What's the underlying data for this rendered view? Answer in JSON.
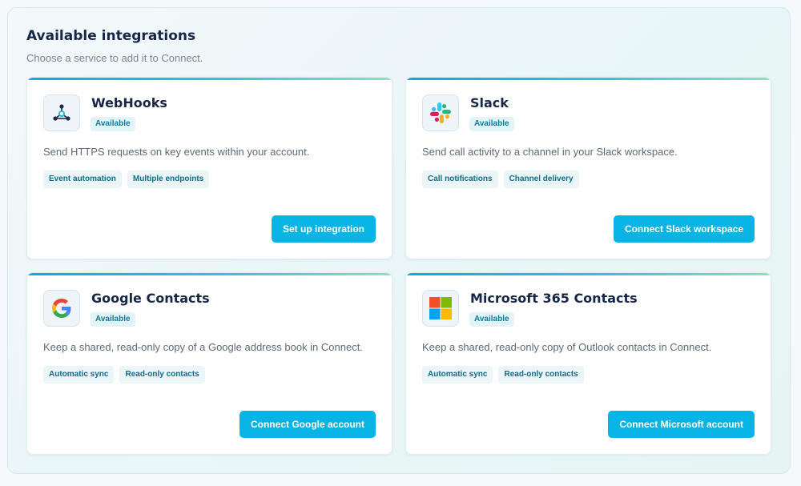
{
  "panel": {
    "title": "Available integrations",
    "subtitle": "Choose a service to add it to Connect."
  },
  "cards": [
    {
      "title": "WebHooks",
      "icon": "webhook-icon",
      "status": "Available",
      "description": "Send HTTPS requests on key events within your account.",
      "tags": [
        "Event automation",
        "Multiple endpoints"
      ],
      "action_label": "Set up integration"
    },
    {
      "title": "Slack",
      "icon": "slack-logo-icon",
      "status": "Available",
      "description": "Send call activity to a channel in your Slack workspace.",
      "tags": [
        "Call notifications",
        "Channel delivery"
      ],
      "action_label": "Connect Slack workspace"
    },
    {
      "title": "Google Contacts",
      "icon": "google-logo-icon",
      "status": "Available",
      "description": "Keep a shared, read-only copy of a Google address book in Connect.",
      "tags": [
        "Automatic sync",
        "Read-only contacts"
      ],
      "action_label": "Connect Google account"
    },
    {
      "title": "Microsoft 365 Contacts",
      "icon": "microsoft-logo-icon",
      "status": "Available",
      "description": "Keep a shared, read-only copy of Outlook contacts in Connect.",
      "tags": [
        "Automatic sync",
        "Read-only contacts"
      ],
      "action_label": "Connect Microsoft account"
    }
  ],
  "colors": {
    "accent": "#08b4e6",
    "title": "#172747",
    "badge_text": "#0e7a98",
    "badge_bg": "#e3f4f8"
  }
}
